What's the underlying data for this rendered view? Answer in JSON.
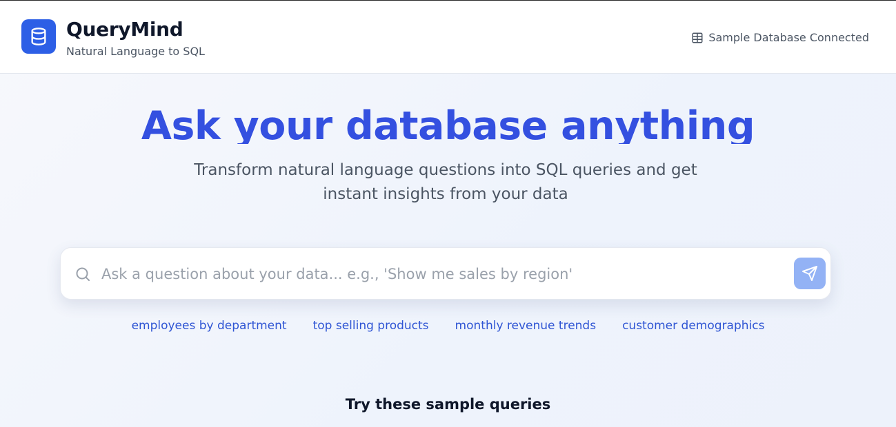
{
  "header": {
    "app_name": "QueryMind",
    "tagline": "Natural Language to SQL",
    "logo_icon": "database-icon",
    "status_icon": "table-icon",
    "status_text": "Sample Database Connected"
  },
  "hero": {
    "title": "Ask your database anything",
    "subtitle": "Transform natural language questions into SQL queries and get instant insights from your data"
  },
  "search": {
    "icon": "search-icon",
    "placeholder": "Ask a question about your data... e.g., 'Show me sales by region'",
    "value": "",
    "submit_icon": "send-icon"
  },
  "suggestions": [
    "employees by department",
    "top selling products",
    "monthly revenue trends",
    "customer demographics"
  ],
  "samples": {
    "heading": "Try these sample queries"
  },
  "colors": {
    "brand": "#2d5fe6",
    "title": "#3450e0",
    "link": "#2f55d4",
    "send_button": "#93b2f5"
  }
}
